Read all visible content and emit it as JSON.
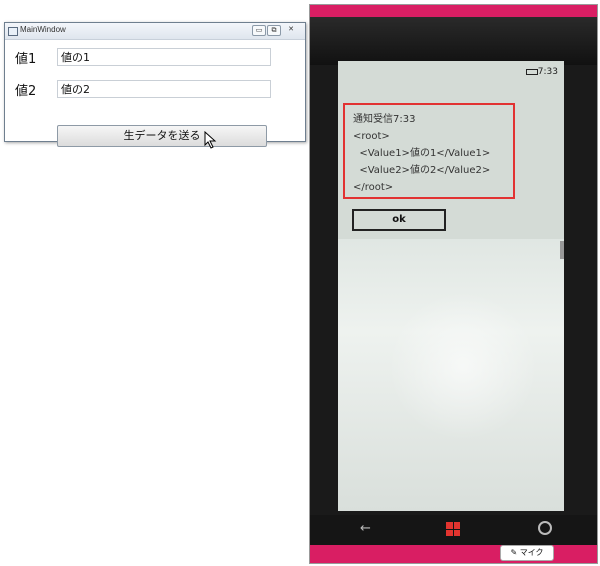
{
  "window": {
    "title": "MainWindow",
    "controls": {
      "minimize": "▭",
      "maximize": "⧉",
      "close": "✕"
    },
    "field1_label": "値1",
    "field1_value": "値の1",
    "field2_label": "値2",
    "field2_value": "値の2",
    "send_button": "生データを送る"
  },
  "phone": {
    "time": "7:33",
    "notification": "通知受信7:33\n<root>\n  <Value1>値の1</Value1>\n  <Value2>値の2</Value2>\n</root>",
    "ok_button": "ok",
    "mic_label": "マイク",
    "colors": {
      "accent": "#d91e63",
      "highlight": "#e23232"
    }
  }
}
